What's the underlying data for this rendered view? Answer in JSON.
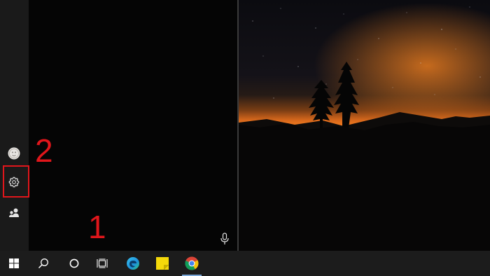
{
  "annotations": {
    "step_1": "1",
    "step_2": "2",
    "highlight_color": "#e0161b"
  },
  "start_menu": {
    "rail": {
      "items": [
        {
          "name": "user-account",
          "icon": "avatar-icon"
        },
        {
          "name": "settings",
          "icon": "gear-icon"
        },
        {
          "name": "contacts",
          "icon": "people-icon"
        }
      ]
    },
    "voice_icon": "microphone-icon"
  },
  "taskbar": {
    "items": [
      {
        "name": "start",
        "icon": "windows-logo-icon"
      },
      {
        "name": "search",
        "icon": "search-icon"
      },
      {
        "name": "cortana",
        "icon": "cortana-ring-icon"
      },
      {
        "name": "task-view",
        "icon": "task-view-icon"
      },
      {
        "name": "edge",
        "icon": "edge-icon"
      },
      {
        "name": "sticky-notes",
        "icon": "sticky-notes-icon"
      },
      {
        "name": "chrome",
        "icon": "chrome-icon",
        "running": true
      }
    ]
  },
  "wallpaper": {
    "description_color_sky": "#0a0a0e",
    "description_color_glow": "#e0711f"
  }
}
